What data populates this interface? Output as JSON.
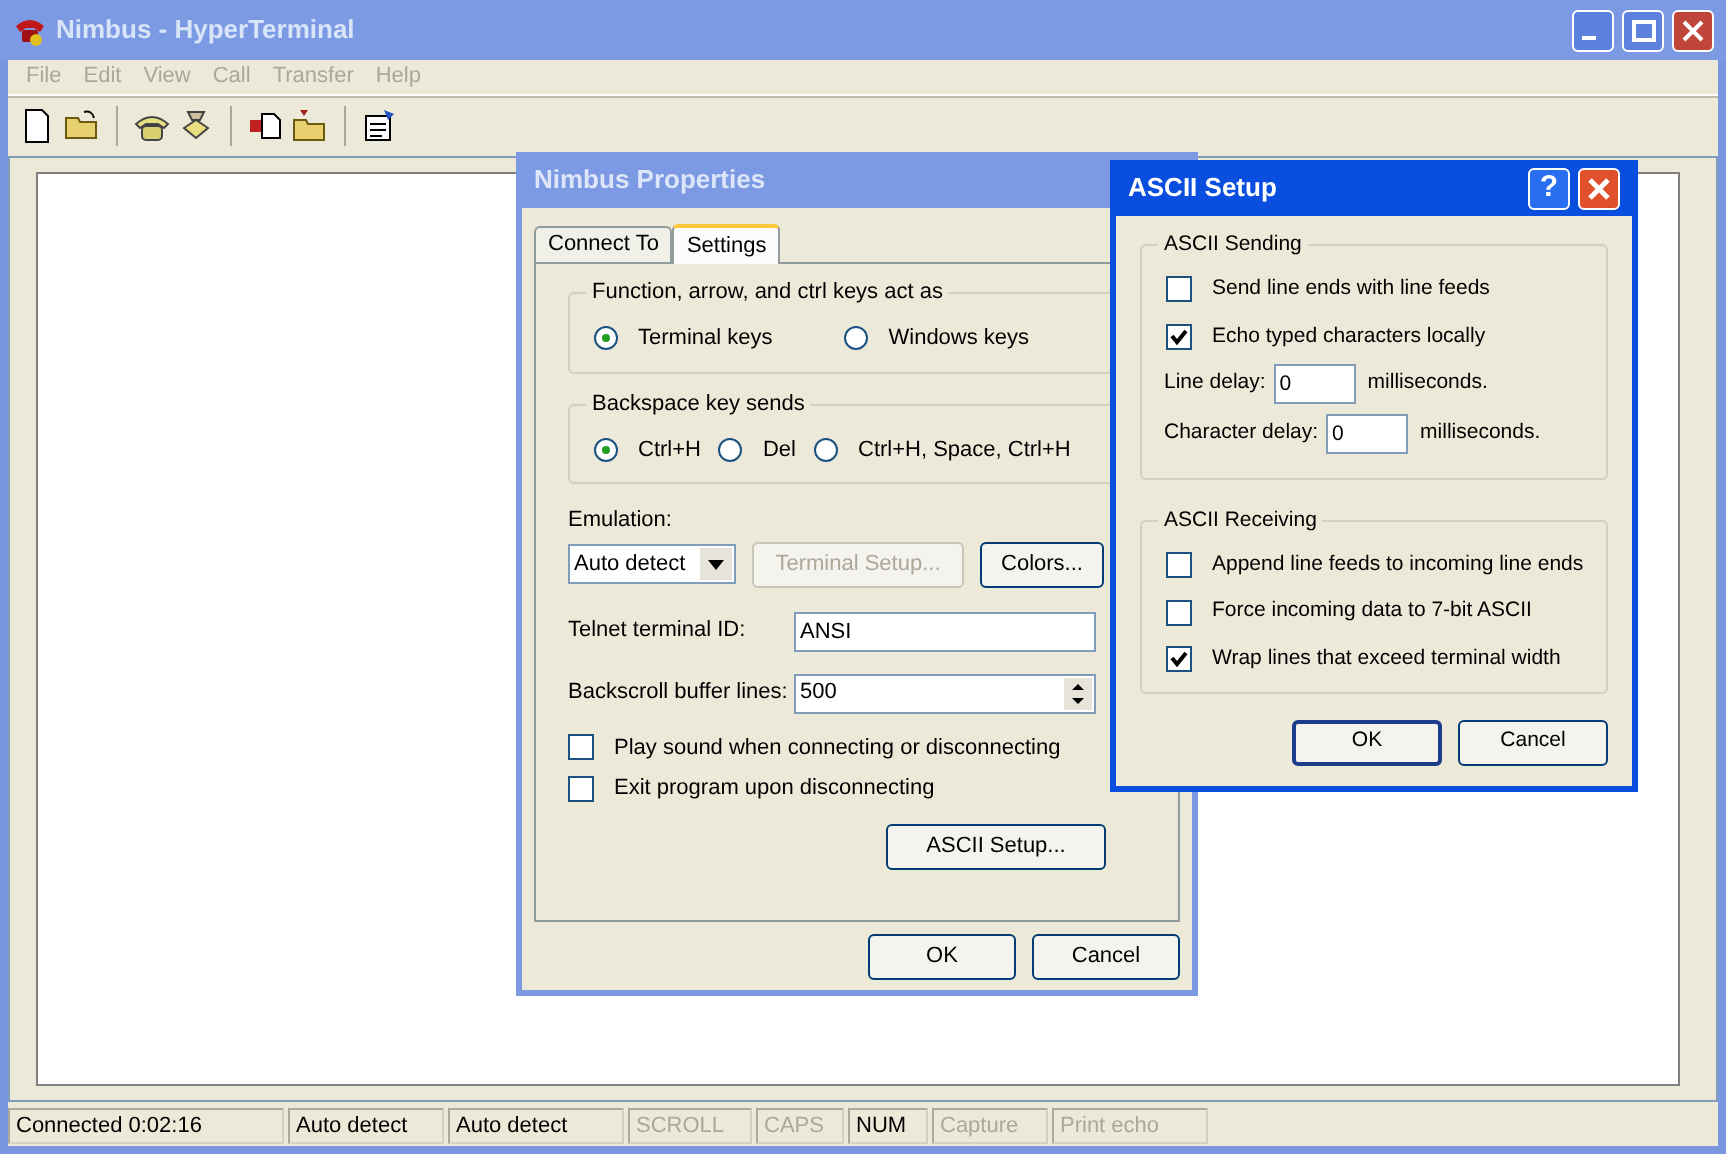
{
  "main_window": {
    "title": "Nimbus - HyperTerminal",
    "active": false,
    "menu": [
      {
        "label": "File",
        "disabled": true
      },
      {
        "label": "Edit",
        "disabled": true
      },
      {
        "label": "View",
        "disabled": true
      },
      {
        "label": "Call",
        "disabled": true
      },
      {
        "label": "Transfer",
        "disabled": true
      },
      {
        "label": "Help",
        "disabled": true
      }
    ],
    "status_bar": [
      {
        "text": "Connected 0:02:16",
        "disabled": false
      },
      {
        "text": "Auto detect",
        "disabled": false
      },
      {
        "text": "Auto detect",
        "disabled": false
      },
      {
        "text": "SCROLL",
        "disabled": true
      },
      {
        "text": "CAPS",
        "disabled": true
      },
      {
        "text": "NUM",
        "disabled": false
      },
      {
        "text": "Capture",
        "disabled": true
      },
      {
        "text": "Print echo",
        "disabled": true
      }
    ]
  },
  "properties_dialog": {
    "title": "Nimbus Properties",
    "active": false,
    "tabs": [
      {
        "label": "Connect To",
        "selected": false
      },
      {
        "label": "Settings",
        "selected": true
      }
    ],
    "keys_group": {
      "title": "Function, arrow, and ctrl keys act as",
      "options": [
        {
          "label": "Terminal keys",
          "selected": true
        },
        {
          "label": "Windows keys",
          "selected": false
        }
      ]
    },
    "backspace_group": {
      "title": "Backspace key sends",
      "options": [
        {
          "label": "Ctrl+H",
          "selected": true
        },
        {
          "label": "Del",
          "selected": false
        },
        {
          "label": "Ctrl+H, Space, Ctrl+H",
          "selected": false
        }
      ]
    },
    "emulation": {
      "label": "Emulation:",
      "value": "Auto detect"
    },
    "terminal_setup_button": {
      "label": "Terminal Setup...",
      "disabled": true
    },
    "colors_button": {
      "label": "Colors...",
      "disabled": false
    },
    "telnet_id": {
      "label": "Telnet terminal ID:",
      "value": "ANSI"
    },
    "backscroll": {
      "label": "Backscroll buffer lines:",
      "value": "500"
    },
    "checkboxes": [
      {
        "label": "Play sound when connecting or disconnecting",
        "checked": false
      },
      {
        "label": "Exit program upon disconnecting",
        "checked": false
      }
    ],
    "ascii_setup_button": "ASCII Setup...",
    "buttons": [
      "OK",
      "Cancel"
    ]
  },
  "ascii_dialog": {
    "title": "ASCII Setup",
    "active": true,
    "help_button": "?",
    "sending": {
      "title": "ASCII Sending",
      "checkboxes": [
        {
          "label": "Send line ends with line feeds",
          "checked": false
        },
        {
          "label": "Echo typed characters locally",
          "checked": true
        }
      ],
      "delays": [
        {
          "label": "Line delay:",
          "value": "0",
          "unit": "milliseconds."
        },
        {
          "label": "Character delay:",
          "value": "0",
          "unit": "milliseconds."
        }
      ]
    },
    "receiving": {
      "title": "ASCII Receiving",
      "checkboxes": [
        {
          "label": "Append line feeds to incoming line ends",
          "checked": false
        },
        {
          "label": "Force incoming data to 7-bit ASCII",
          "checked": false
        },
        {
          "label": "Wrap lines that exceed terminal width",
          "checked": true
        }
      ]
    },
    "buttons": [
      "OK",
      "Cancel"
    ]
  }
}
